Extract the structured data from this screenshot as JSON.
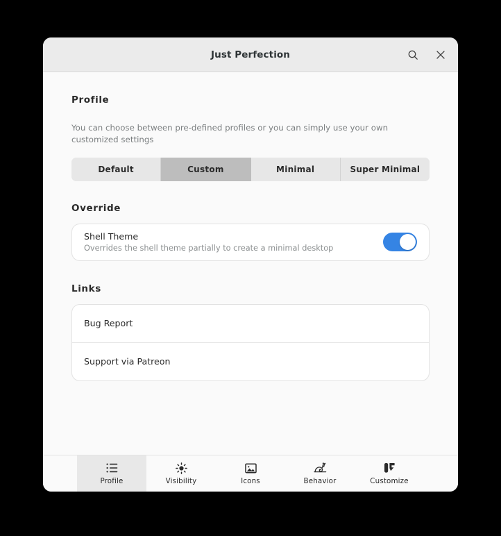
{
  "window": {
    "title": "Just Perfection",
    "search_icon": "search-icon",
    "close_icon": "close-icon"
  },
  "profile": {
    "heading": "Profile",
    "description": "You can choose between pre-defined profiles or you can simply use your own customized settings",
    "options": [
      {
        "label": "Default",
        "selected": false
      },
      {
        "label": "Custom",
        "selected": true
      },
      {
        "label": "Minimal",
        "selected": false
      },
      {
        "label": "Super Minimal",
        "selected": false
      }
    ],
    "selected": "Custom"
  },
  "override": {
    "heading": "Override",
    "rows": [
      {
        "title": "Shell Theme",
        "subtitle": "Overrides the shell theme partially to create a minimal desktop",
        "toggle": "on"
      }
    ]
  },
  "links": {
    "heading": "Links",
    "items": [
      {
        "label": "Bug Report"
      },
      {
        "label": "Support via Patreon"
      }
    ]
  },
  "tabbar": {
    "items": [
      {
        "label": "Profile",
        "icon": "list-icon",
        "selected": true
      },
      {
        "label": "Visibility",
        "icon": "brightness-icon",
        "selected": false
      },
      {
        "label": "Icons",
        "icon": "image-icon",
        "selected": false
      },
      {
        "label": "Behavior",
        "icon": "snail-icon",
        "selected": false
      },
      {
        "label": "Customize",
        "icon": "paint-icon",
        "selected": false
      }
    ]
  },
  "colors": {
    "accent": "#3584e4",
    "header_bg": "#ebebeb",
    "body_bg": "#fafafa",
    "selected_segment": "#bdbdbd"
  }
}
